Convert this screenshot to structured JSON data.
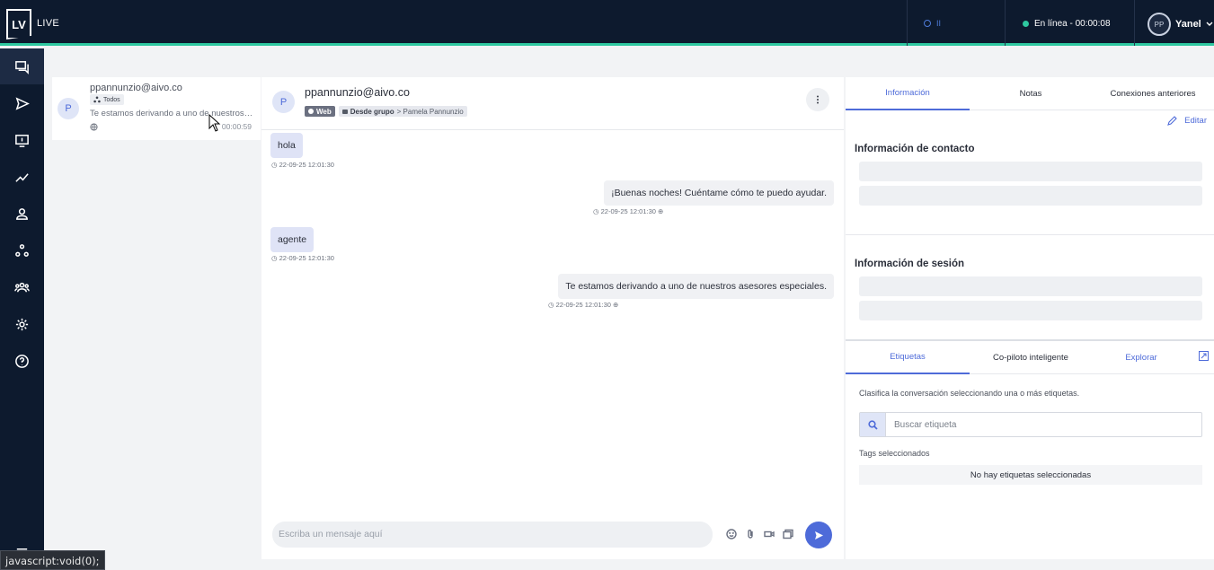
{
  "topbar": {
    "logo": "LV",
    "app_name": "LIVE",
    "indicator": "II",
    "status_text": "En línea - 00:00:08",
    "user_initials": "PP",
    "user_name": "Yanel"
  },
  "sidebar": {
    "items": [
      {
        "icon": "chat-icon",
        "active": true
      },
      {
        "icon": "send-icon"
      },
      {
        "icon": "monitor-icon"
      },
      {
        "icon": "chart-line-icon"
      },
      {
        "icon": "user-icon"
      },
      {
        "icon": "groups-icon"
      },
      {
        "icon": "team-icon"
      },
      {
        "icon": "gear-icon"
      },
      {
        "icon": "help-icon"
      }
    ]
  },
  "status_tooltip": "javascript:void(0);",
  "conversation": {
    "avatar_letter": "P",
    "email": "ppannunzio@aivo.co",
    "badge": "Todos",
    "preview": "Te estamos derivando a uno de nuestros asesores especiales.",
    "time": "00:00:59"
  },
  "chat": {
    "avatar_letter": "P",
    "email": "ppannunzio@aivo.co",
    "channel": "Web",
    "group_label": "Desde grupo",
    "group_target": "> Pamela Pannunzio",
    "composer_placeholder": "Escriba un mensaje aquí",
    "messages": [
      {
        "direction": "in",
        "text": "hola",
        "meta": "22-09-25 12:01:30"
      },
      {
        "direction": "out",
        "text": "¡Buenas noches! Cuéntame cómo te puedo ayudar.",
        "meta": "22-09-25 12:01:30"
      },
      {
        "direction": "in",
        "text": "agente",
        "meta": "22-09-25 12:01:30"
      },
      {
        "direction": "out",
        "text": "Te estamos derivando a uno de nuestros asesores especiales.",
        "meta": "22-09-25 12:01:30"
      }
    ]
  },
  "info_panel": {
    "tabs": [
      "Información",
      "Notas",
      "Conexiones anteriores"
    ],
    "edit_label": "Editar",
    "contact_title": "Información de contacto",
    "session_title": "Información de sesión"
  },
  "tags_panel": {
    "tabs": [
      "Etiquetas",
      "Co-piloto inteligente",
      "Explorar"
    ],
    "hint": "Clasifica la conversación seleccionando una o más etiquetas.",
    "search_placeholder": "Buscar etiqueta",
    "selected_label": "Tags seleccionados",
    "empty_text": "No hay etiquetas seleccionadas"
  },
  "colors": {
    "navy": "#0d1a2e",
    "accent": "#4e6bd9",
    "online": "#2ec8a0"
  }
}
